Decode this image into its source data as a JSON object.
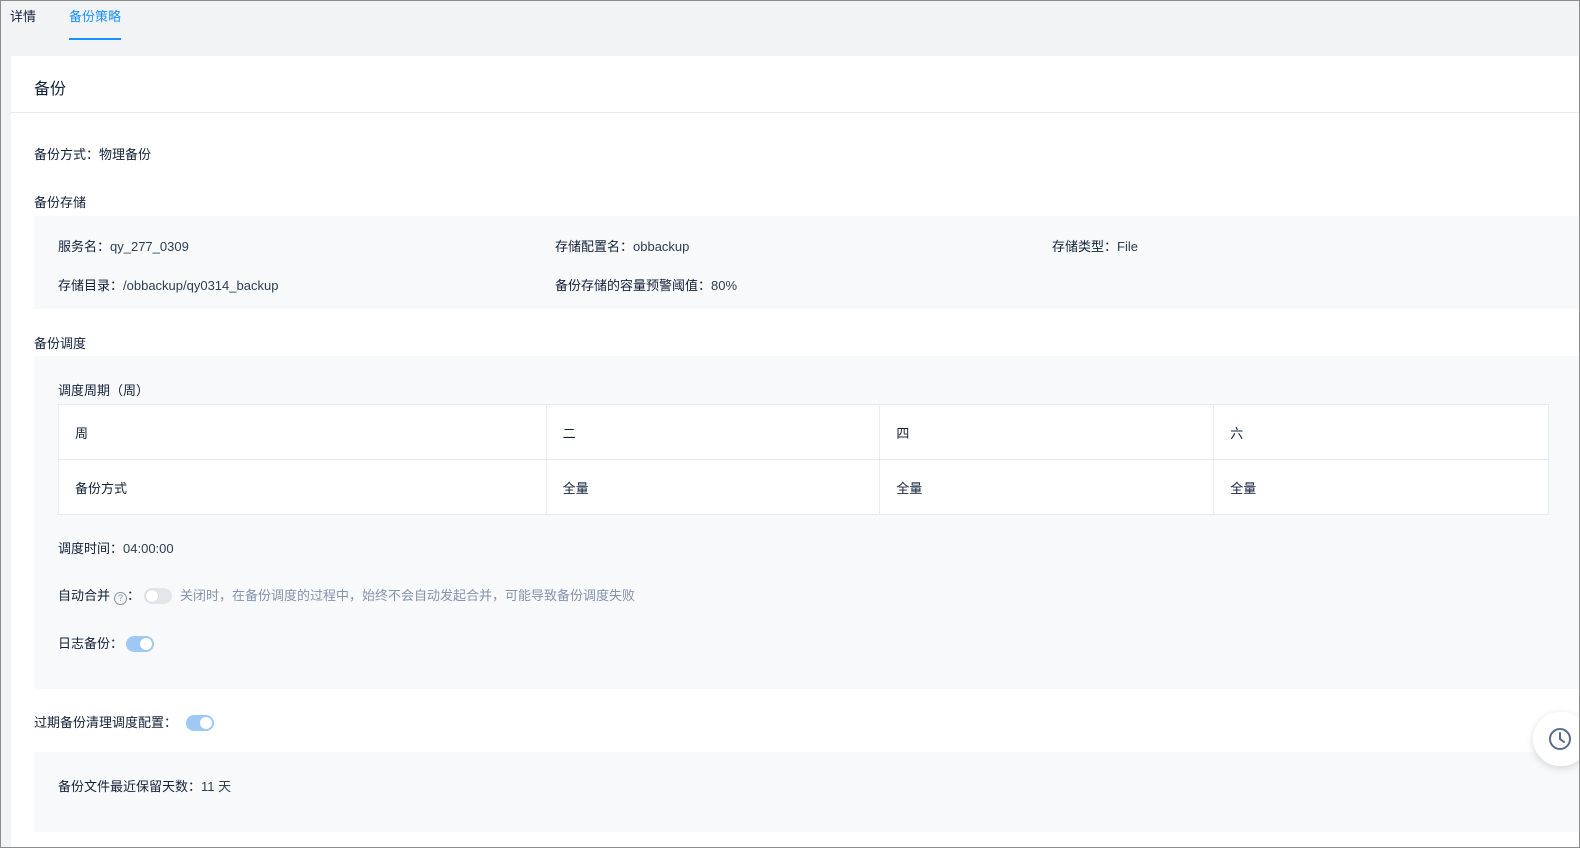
{
  "tabs": [
    {
      "label": "详情"
    },
    {
      "label": "备份策略"
    }
  ],
  "card": {
    "title": "备份"
  },
  "backup_method": {
    "label": "备份方式：",
    "value": "物理备份"
  },
  "storage": {
    "section_label": "备份存储",
    "service_name": {
      "label": "服务名：",
      "value": "qy_277_0309"
    },
    "config_name": {
      "label": "存储配置名：",
      "value": "obbackup"
    },
    "storage_type": {
      "label": "存储类型：",
      "value": "File"
    },
    "directory": {
      "label": "存储目录：",
      "value": "/obbackup/qy0314_backup"
    },
    "threshold": {
      "label": "备份存储的容量预警阈值：",
      "value": "80%"
    }
  },
  "schedule": {
    "section_label": "备份调度",
    "period_label": "调度周期（周）",
    "table": {
      "rows": [
        [
          "周",
          "二",
          "四",
          "六"
        ],
        [
          "备份方式",
          "全量",
          "全量",
          "全量"
        ]
      ]
    },
    "time": {
      "label": "调度时间：",
      "value": "04:00:00"
    },
    "auto_merge": {
      "label": "自动合并",
      "help_glyph": "?",
      "colon": "：",
      "enabled": false,
      "hint": "关闭时，在备份调度的过程中，始终不会自动发起合并，可能导致备份调度失败"
    },
    "log_backup": {
      "label": "日志备份：",
      "enabled": true
    }
  },
  "expire_cleanup": {
    "label": "过期备份清理调度配置：",
    "enabled": true,
    "retention": {
      "label": "备份文件最近保留天数：",
      "value": "11 天"
    }
  },
  "colors": {
    "accent": "#1890ff",
    "toggle_on": "#9fc9f5",
    "toggle_off": "#e4e6ea"
  }
}
